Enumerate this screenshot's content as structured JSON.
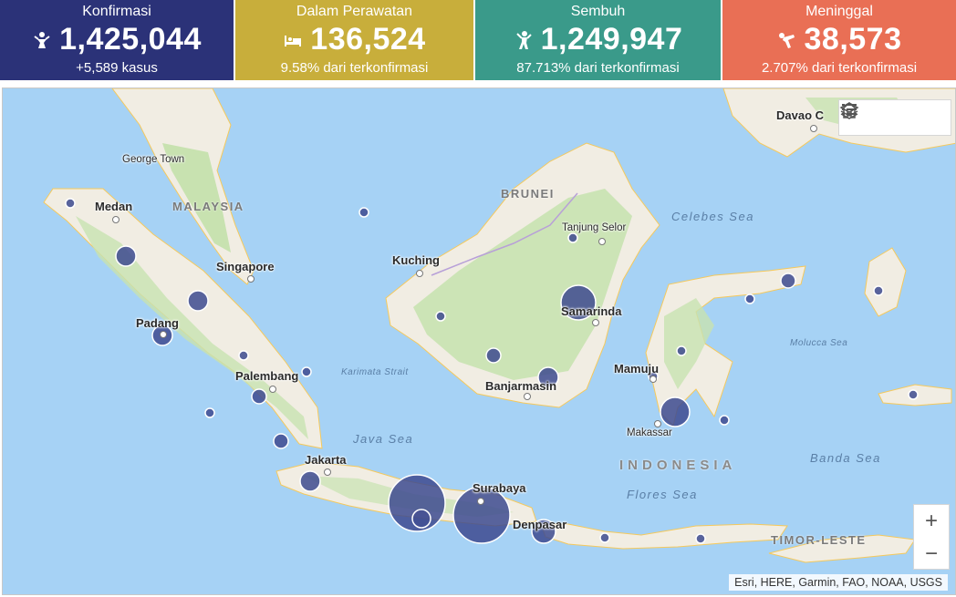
{
  "stats": [
    {
      "label": "Konfirmasi",
      "value": "1,425,044",
      "sub": "+5,589 kasus",
      "color": "#2b3278",
      "icon": "person-icon"
    },
    {
      "label": "Dalam Perawatan",
      "value": "136,524",
      "sub": "9.58% dari terkonfirmasi",
      "color": "#c8ae3b",
      "icon": "hospital-bed-icon"
    },
    {
      "label": "Sembuh",
      "value": "1,249,947",
      "sub": "87.713% dari terkonfirmasi",
      "color": "#3a9a8a",
      "icon": "recovered-person-icon"
    },
    {
      "label": "Meninggal",
      "value": "38,573",
      "sub": "2.707% dari terkonfirmasi",
      "color": "#e96f55",
      "icon": "fallen-person-icon"
    }
  ],
  "map": {
    "places": {
      "medan": "Medan",
      "george_town": "George Town",
      "singapore": "Singapore",
      "padang": "Padang",
      "palembang": "Palembang",
      "jakarta": "Jakarta",
      "kuching": "Kuching",
      "banjarmasin": "Banjarmasin",
      "samarinda": "Samarinda",
      "tanjung_selor": "Tanjung Selor",
      "mamuju": "Mamuju",
      "makassar": "Makassar",
      "surabaya": "Surabaya",
      "denpasar": "Denpasar",
      "davao": "Davao C"
    },
    "countries": {
      "malaysia": "MALAYSIA",
      "brunei": "BRUNEI",
      "indonesia": "INDONESIA",
      "timor_leste": "TIMOR-LESTE"
    },
    "seas": {
      "java_sea": "Java Sea",
      "celebes_sea": "Celebes Sea",
      "banda_sea": "Banda Sea",
      "flores_sea": "Flores Sea",
      "karimata": "Karimata Strait",
      "molucca": "Molucca Sea"
    },
    "toolbar": {
      "home": "home-icon",
      "legend": "legend-list-icon",
      "layers": "layers-icon"
    },
    "zoom_in": "+",
    "zoom_out": "−",
    "attribution": "Esri, HERE, Garmin, FAO, NOAA, USGS",
    "colors": {
      "water": "#a6d2f5",
      "land": "#f1ede3",
      "forest": "#c8e2b0",
      "bubble": "#3d4a8f",
      "road": "#f5c95c"
    }
  }
}
